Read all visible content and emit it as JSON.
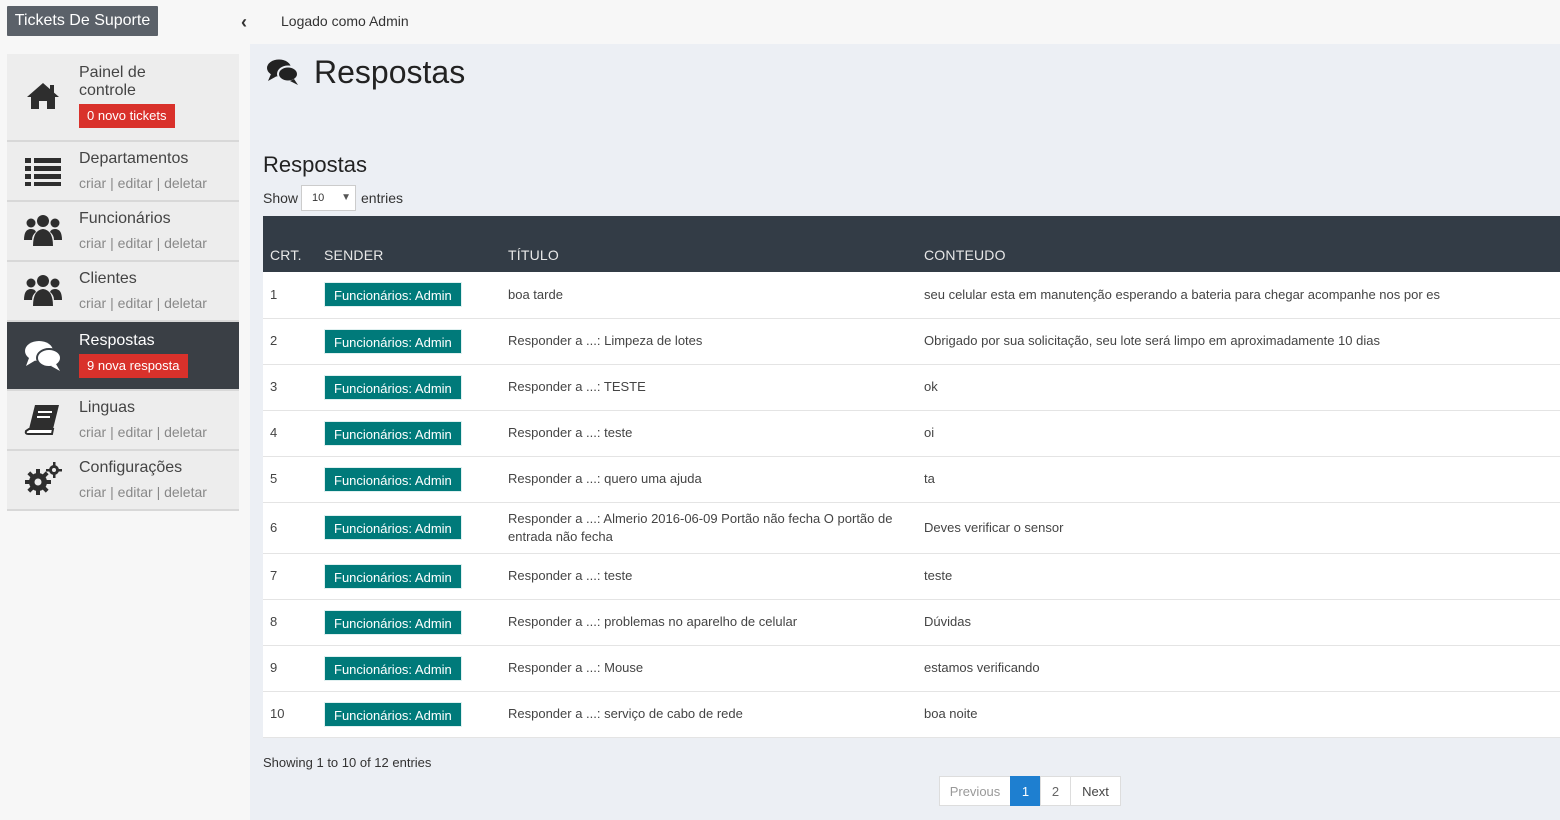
{
  "app": {
    "brand": "Tickets De Suporte",
    "login_status": "Logado como Admin"
  },
  "sidebar": {
    "items": [
      {
        "title_line1": "Painel de",
        "title_line2": "controle",
        "badge": "0 novo tickets"
      },
      {
        "title": "Departamentos",
        "links": [
          "criar",
          "editar",
          "deletar"
        ]
      },
      {
        "title": "Funcionários",
        "links": [
          "criar",
          "editar",
          "deletar"
        ]
      },
      {
        "title": "Clientes",
        "links": [
          "criar",
          "editar",
          "deletar"
        ]
      },
      {
        "title": "Respostas",
        "badge": "9 nova resposta"
      },
      {
        "title": "Linguas",
        "links": [
          "criar",
          "editar",
          "deletar"
        ]
      },
      {
        "title": "Configurações",
        "links": [
          "criar",
          "editar",
          "deletar"
        ]
      }
    ],
    "link_separator": " | "
  },
  "page": {
    "title": "Respostas",
    "section_title": "Respostas",
    "length": {
      "show_label": "Show",
      "value": "10",
      "entries_label": "entries"
    }
  },
  "table": {
    "headers": [
      "CRT.",
      "SENDER",
      "TÍTULO",
      "CONTEUDO"
    ],
    "rows": [
      {
        "crt": "1",
        "sender": "Funcionários: Admin",
        "title": "boa tarde",
        "content": "seu celular esta em manutenção esperando a bateria para chegar acompanhe nos por es"
      },
      {
        "crt": "2",
        "sender": "Funcionários: Admin",
        "title": "Responder a ...: Limpeza de lotes",
        "content": "Obrigado por sua solicitação, seu lote será limpo em aproximadamente 10 dias"
      },
      {
        "crt": "3",
        "sender": "Funcionários: Admin",
        "title": "Responder a ...: TESTE",
        "content": "ok"
      },
      {
        "crt": "4",
        "sender": "Funcionários: Admin",
        "title": "Responder a ...: teste",
        "content": "oi"
      },
      {
        "crt": "5",
        "sender": "Funcionários: Admin",
        "title": "Responder a ...: quero uma ajuda",
        "content": "ta"
      },
      {
        "crt": "6",
        "sender": "Funcionários: Admin",
        "title": "Responder a ...: Almerio 2016-06-09 Portão não fecha O portão de entrada não fecha",
        "content": "Deves verificar o sensor"
      },
      {
        "crt": "7",
        "sender": "Funcionários: Admin",
        "title": "Responder a ...: teste",
        "content": "teste"
      },
      {
        "crt": "8",
        "sender": "Funcionários: Admin",
        "title": "Responder a ...: problemas no aparelho de celular",
        "content": "Dúvidas"
      },
      {
        "crt": "9",
        "sender": "Funcionários: Admin",
        "title": "Responder a ...: Mouse",
        "content": "estamos verificando"
      },
      {
        "crt": "10",
        "sender": "Funcionários: Admin",
        "title": "Responder a ...: serviço de cabo de rede",
        "content": "boa noite"
      }
    ]
  },
  "footer": {
    "info": "Showing 1 to 10 of 12 entries",
    "pagination": {
      "previous": "Previous",
      "pages": [
        "1",
        "2"
      ],
      "active_page": "1",
      "next": "Next"
    }
  },
  "colors": {
    "active_nav": "#3a3f45",
    "badge_red": "#d9312b",
    "sender_badge": "#007a7a",
    "table_header": "#333c46",
    "active_page": "#1e7fd0"
  },
  "icons": [
    "home-icon",
    "list-icon",
    "users-icon",
    "users-icon",
    "comments-icon",
    "book-icon",
    "gears-icon"
  ]
}
